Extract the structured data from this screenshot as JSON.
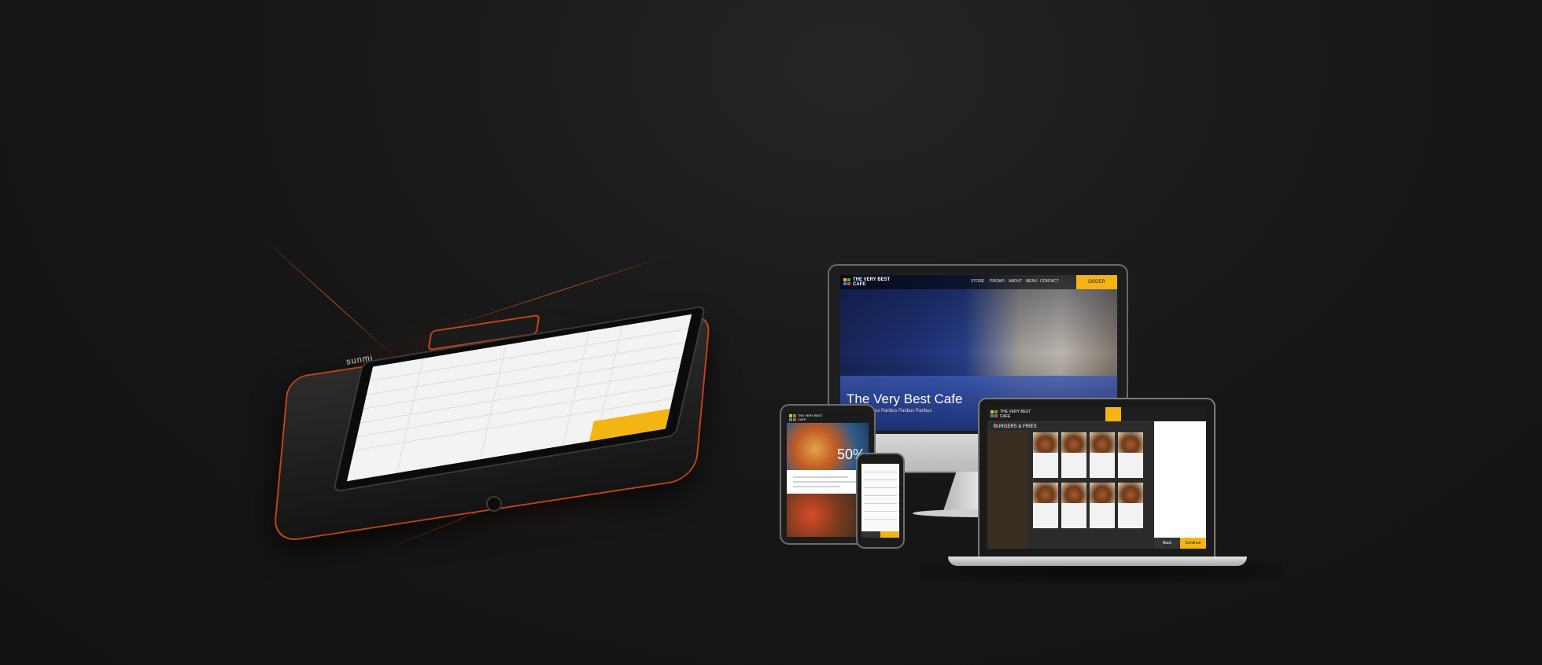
{
  "pos": {
    "brand": "sunmi"
  },
  "website": {
    "logo": "THE VERY BEST CAFE",
    "nav": [
      "STORE",
      "PROMO",
      "ABOUT",
      "MENU",
      "CONTACT"
    ],
    "order_button": "ORDER",
    "hero_title": "The Very Best Cafe",
    "hero_subtitle": "Paribus Paribus Paribus Paribus Paribus"
  },
  "tablet": {
    "logo": "THE VERY BEST CAFE",
    "promo": "50%"
  },
  "laptop": {
    "logo": "THE VERY BEST CAFE",
    "section_title": "BURGERS & FRIES",
    "cart_button_back": "Back",
    "cart_button_continue": "Continue"
  },
  "colors": {
    "accent": "#f4b514",
    "pos_glow": "#c2431c"
  }
}
